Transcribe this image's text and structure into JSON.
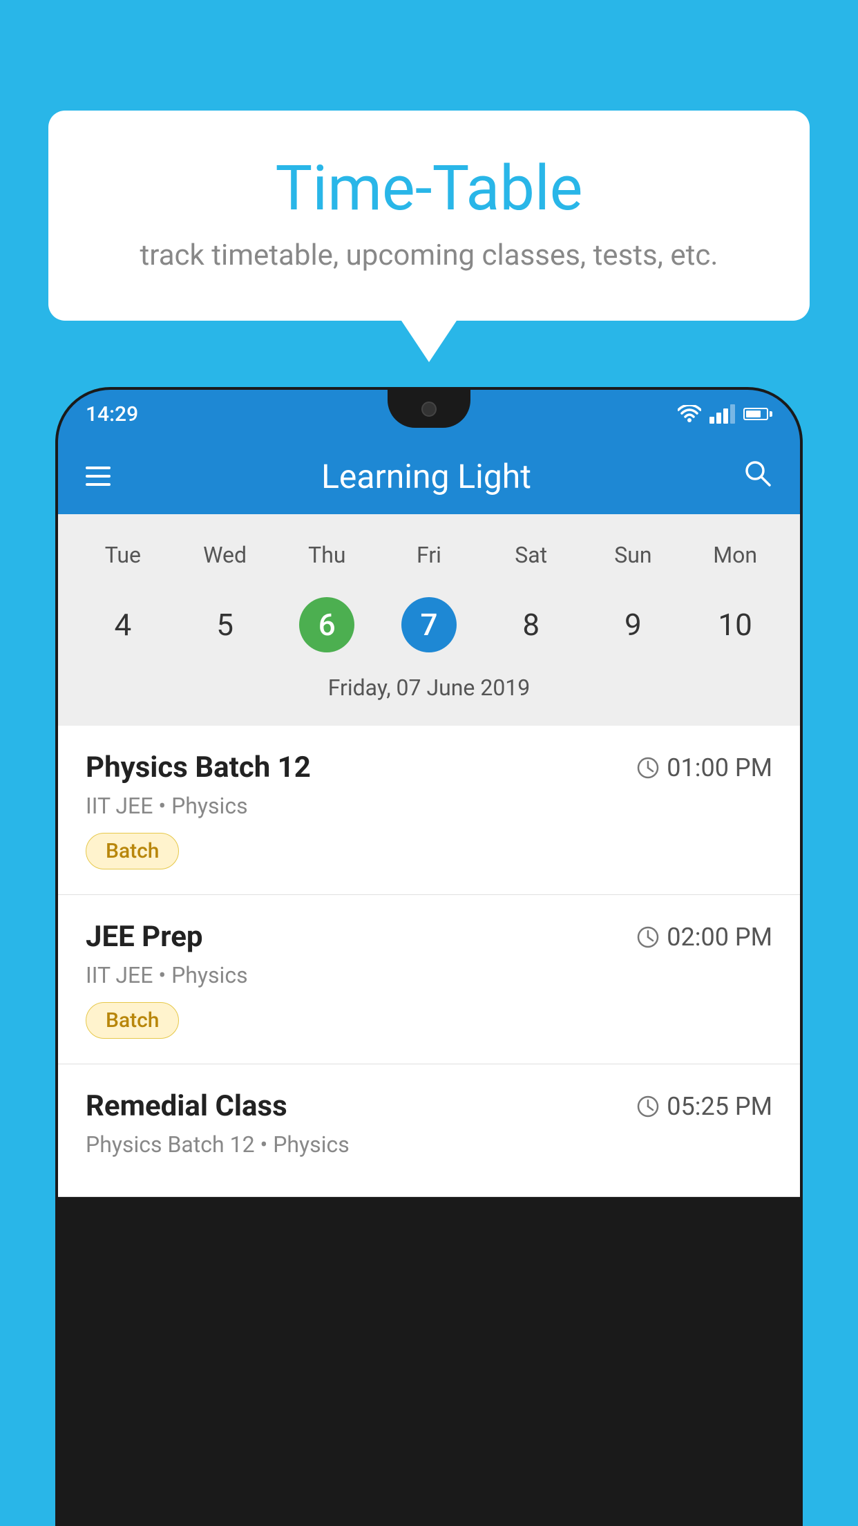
{
  "background_color": "#29b6e8",
  "speech_bubble": {
    "title": "Time-Table",
    "subtitle": "track timetable, upcoming classes, tests, etc."
  },
  "status_bar": {
    "time": "14:29"
  },
  "app_bar": {
    "title": "Learning Light"
  },
  "calendar": {
    "days": [
      "Tue",
      "Wed",
      "Thu",
      "Fri",
      "Sat",
      "Sun",
      "Mon"
    ],
    "dates": [
      "4",
      "5",
      "6",
      "7",
      "8",
      "9",
      "10"
    ],
    "today_index": 2,
    "selected_index": 3,
    "selected_date_label": "Friday, 07 June 2019"
  },
  "classes": [
    {
      "name": "Physics Batch 12",
      "time": "01:00 PM",
      "meta": "IIT JEE • Physics",
      "badge": "Batch"
    },
    {
      "name": "JEE Prep",
      "time": "02:00 PM",
      "meta": "IIT JEE • Physics",
      "badge": "Batch"
    },
    {
      "name": "Remedial Class",
      "time": "05:25 PM",
      "meta": "Physics Batch 12 • Physics",
      "badge": null
    }
  ],
  "icons": {
    "hamburger": "☰",
    "search": "🔍",
    "clock": "🕐"
  }
}
